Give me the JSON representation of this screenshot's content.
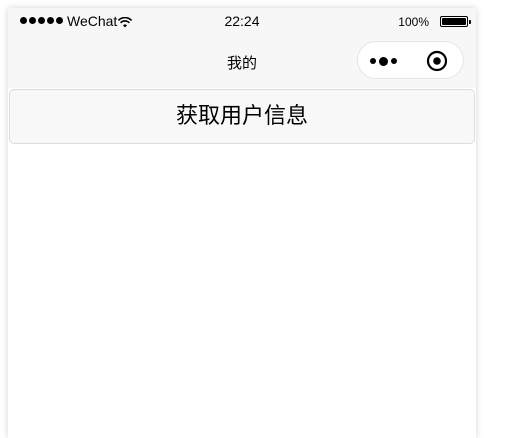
{
  "status_bar": {
    "carrier": "WeChat",
    "time": "22:24",
    "battery_percent": "100%",
    "signal_icon": "signal-dots-icon",
    "wifi_icon": "wifi-icon",
    "battery_icon": "battery-icon"
  },
  "nav_bar": {
    "title": "我的",
    "more_icon": "more-dots-icon",
    "close_icon": "close-target-icon"
  },
  "main": {
    "get_userinfo_label": "获取用户信息"
  }
}
